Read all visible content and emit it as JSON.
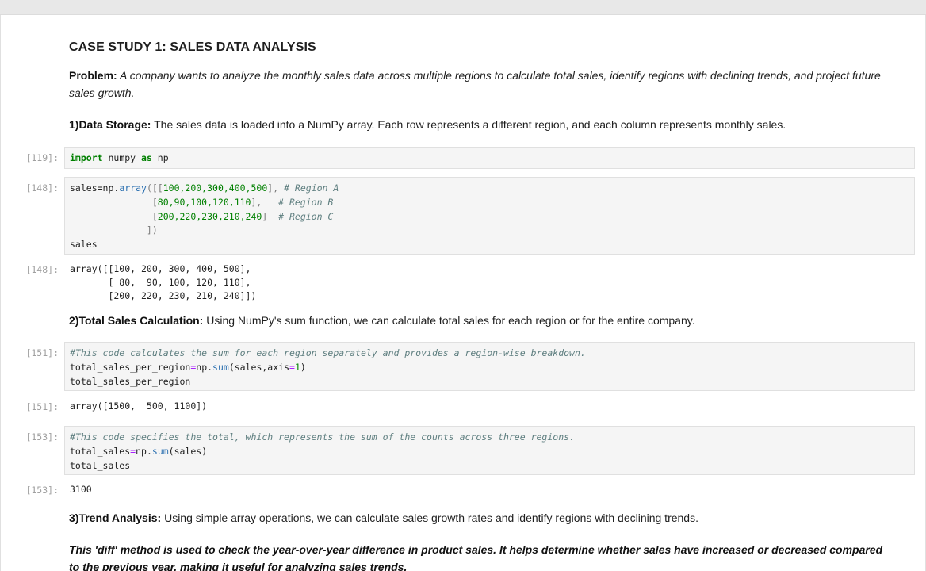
{
  "heading": "CASE STUDY 1: SALES DATA ANALYSIS",
  "problem": {
    "label": "Problem:",
    "text": " A company wants to analyze the monthly sales data across multiple regions to calculate total sales, identify regions with declining trends, and project future sales growth."
  },
  "step1": {
    "label": "1)Data Storage:",
    "text": " The sales data is loaded into a NumPy array. Each row represents a different region, and each column represents monthly sales."
  },
  "cells": {
    "c119": {
      "prompt": "[119]:",
      "import_kw": "import",
      "module": " numpy ",
      "as_kw": "as",
      "alias": " np"
    },
    "c148": {
      "prompt": "[148]:",
      "line1_a": "sales=np.",
      "line1_fn": "array",
      "line1_b": "([[",
      "line1_nums": "100,200,300,400,500",
      "line1_c": "], ",
      "line1_cm": "# Region A",
      "line2_pad": "               [",
      "line2_nums": "80,90,100,120,110",
      "line2_c": "],   ",
      "line2_cm": "# Region B",
      "line3_pad": "               [",
      "line3_nums": "200,220,230,210,240",
      "line3_c": "]  ",
      "line3_cm": "# Region C",
      "line4": "              ])",
      "line5": "sales",
      "out_prompt": "[148]:",
      "output": "array([[100, 200, 300, 400, 500],\n       [ 80,  90, 100, 120, 110],\n       [200, 220, 230, 210, 240]])"
    },
    "c151": {
      "prompt": "[151]:",
      "comment": "#This code calculates the sum for each region separately and provides a region-wise breakdown.",
      "line2_a": "total_sales_per_region",
      "line2_eq": "=",
      "line2_b": "np.",
      "line2_fn": "sum",
      "line2_c": "(sales,axis",
      "line2_eq2": "=",
      "line2_num": "1",
      "line2_d": ")",
      "line3": "total_sales_per_region",
      "out_prompt": "[151]:",
      "output": "array([1500,  500, 1100])"
    },
    "c153": {
      "prompt": "[153]:",
      "comment": "#This code specifies the total, which represents the sum of the counts across three regions.",
      "line2_a": "total_sales",
      "line2_eq": "=",
      "line2_b": "np.",
      "line2_fn": "sum",
      "line2_c": "(sales)",
      "line3": "total_sales",
      "out_prompt": "[153]:",
      "output": "3100"
    }
  },
  "step2": {
    "label": "2)Total Sales Calculation:",
    "text": " Using NumPy's sum function, we can calculate total sales for each region or for the entire company."
  },
  "step3": {
    "label": "3)Trend Analysis:",
    "text": " Using simple array operations, we can calculate sales growth rates and identify regions with declining trends."
  },
  "diff_note": "This 'diff' method is used to check the year-over-year difference in product sales. It helps determine whether sales have increased or decreased compared to the previous year, making it useful for analyzing sales trends."
}
